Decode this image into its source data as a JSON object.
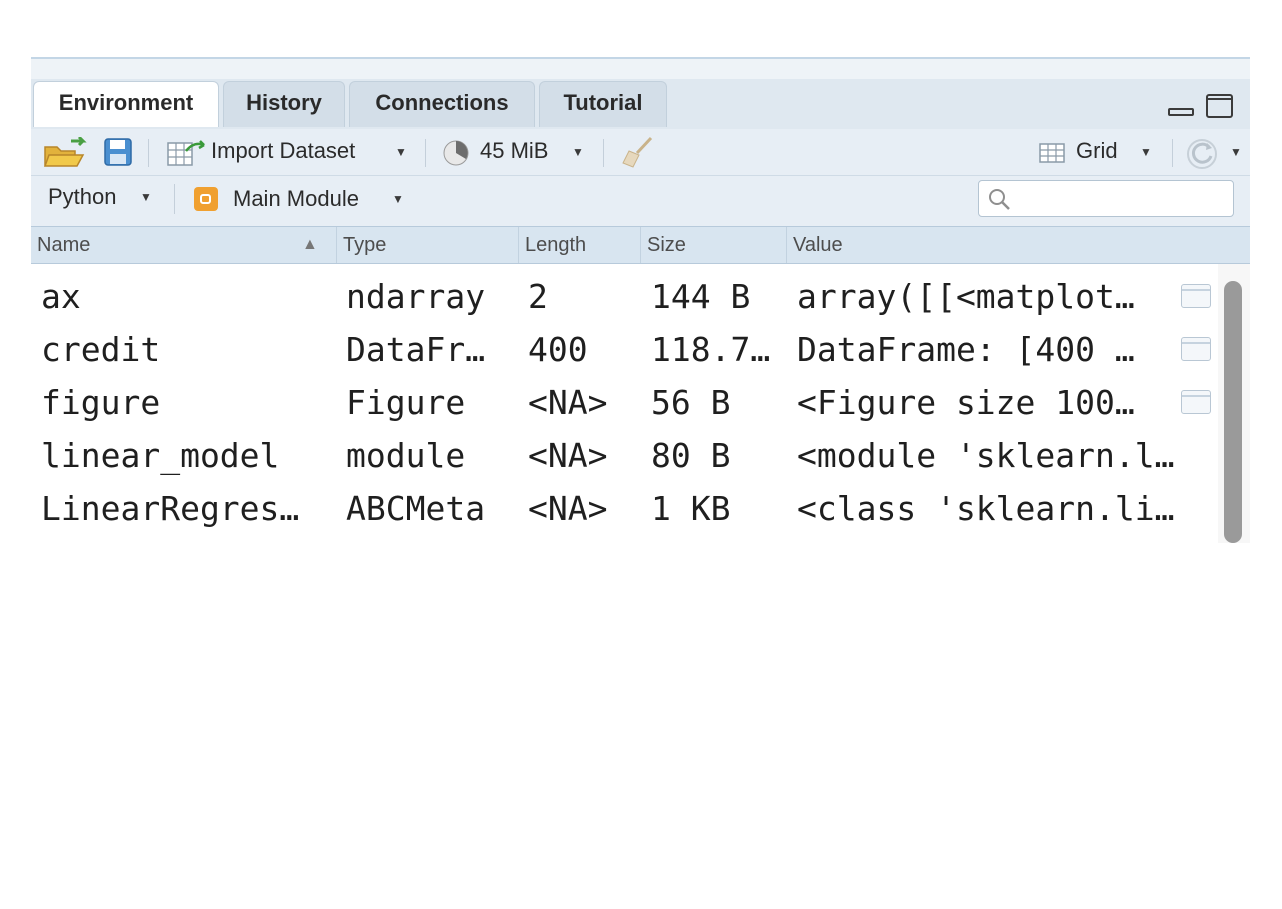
{
  "tabs": [
    {
      "label": "Environment",
      "active": true
    },
    {
      "label": "History",
      "active": false
    },
    {
      "label": "Connections",
      "active": false
    },
    {
      "label": "Tutorial",
      "active": false
    }
  ],
  "toolbar": {
    "import_label": "Import Dataset",
    "memory_label": "45 MiB",
    "view_label": "Grid"
  },
  "context": {
    "language": "Python",
    "module": "Main Module",
    "search_placeholder": ""
  },
  "columns": [
    "Name",
    "Type",
    "Length",
    "Size",
    "Value"
  ],
  "rows": [
    {
      "name": "ax",
      "type": "ndarray",
      "length": "2",
      "size": "144 B",
      "value": "array([[<matplot…",
      "viewable": true
    },
    {
      "name": "credit",
      "type": "DataFr…",
      "length": "400",
      "size": "118.7…",
      "value": "DataFrame: [400 …",
      "viewable": true
    },
    {
      "name": "figure",
      "type": "Figure",
      "length": "<NA>",
      "size": "56 B",
      "value": "<Figure size 100…",
      "viewable": true
    },
    {
      "name": "linear_model",
      "type": "module",
      "length": "<NA>",
      "size": "80 B",
      "value": "<module 'sklearn.l…",
      "viewable": false
    },
    {
      "name": "LinearRegres…",
      "type": "ABCMeta",
      "length": "<NA>",
      "size": "1 KB",
      "value": "<class 'sklearn.li…",
      "viewable": false
    }
  ],
  "colors": {
    "tab_bar": "#dfe8f0",
    "toolbar": "#e7eef5",
    "header": "#d8e5f0",
    "module_badge": "#f0a030"
  }
}
